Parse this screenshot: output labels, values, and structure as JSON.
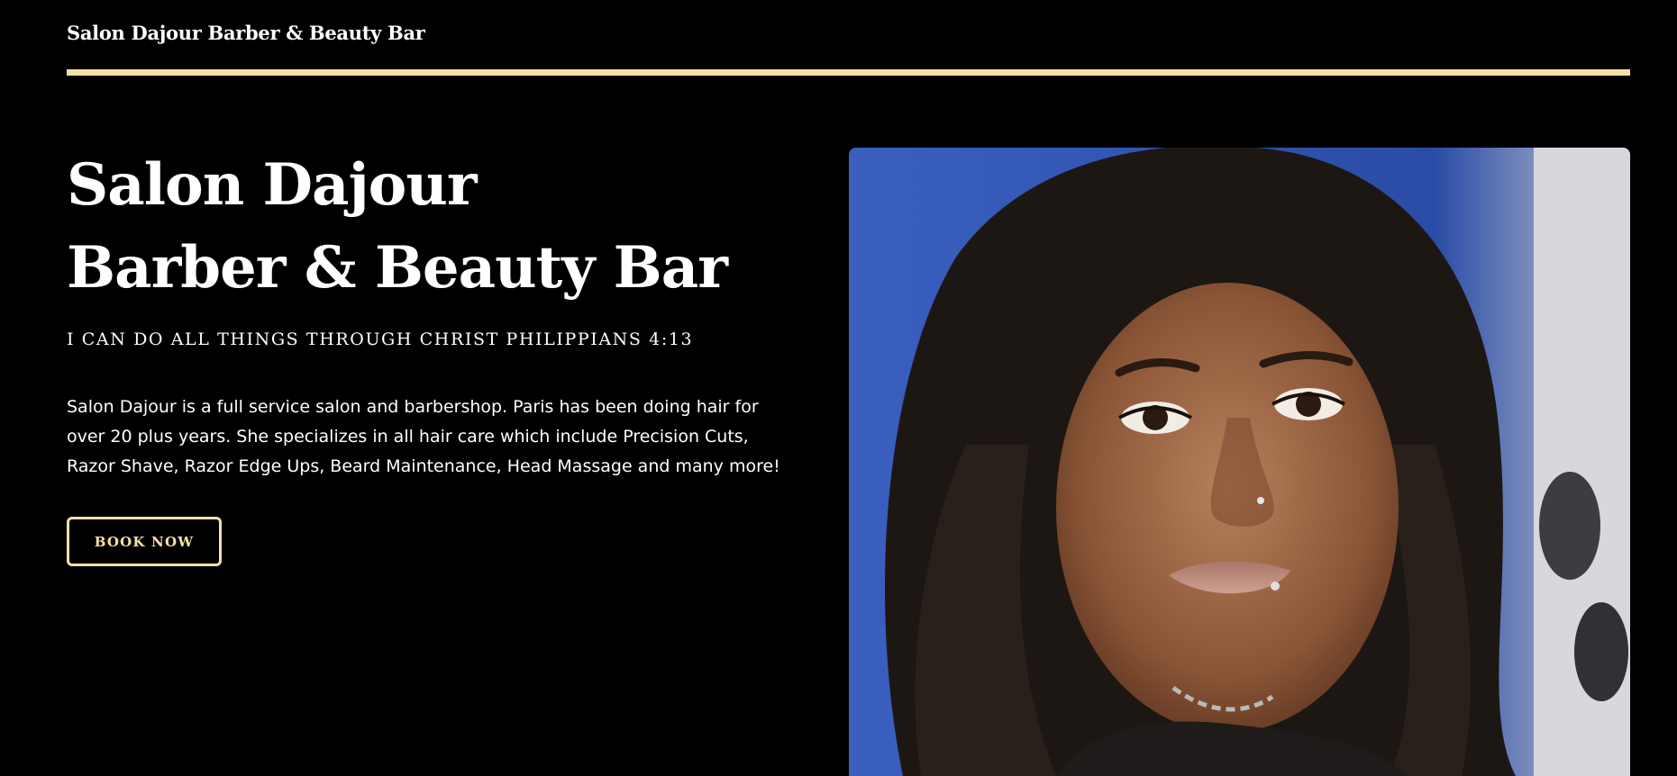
{
  "header": {
    "brand": "Salon Dajour Barber & Beauty Bar",
    "rule_color": "#f5e1a4"
  },
  "hero": {
    "title_line1": "Salon Dajour",
    "title_line2": "Barber & Beauty Bar",
    "tagline": "I CAN DO ALL THINGS THROUGH CHRIST PHILIPPIANS 4:13",
    "description": "Salon Dajour is a full service salon and barbershop. Paris has been doing hair for over 20 plus years. She specializes in all hair care which include Precision Cuts, Razor Shave, Razor Edge Ups, Beard Maintenance, Head Massage and many more!",
    "cta_label": "BOOK NOW",
    "accent_color": "#f5e1a4"
  },
  "photo": {
    "subject": "portrait of woman with long curly dark hair",
    "background_color": "#2c4fa8"
  }
}
